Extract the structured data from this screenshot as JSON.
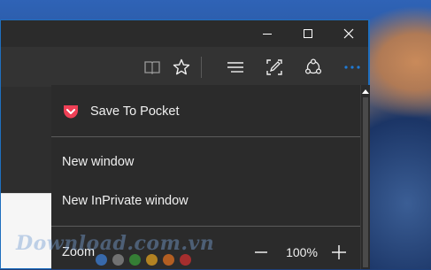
{
  "toolbar": {
    "reading_view_icon": "book-icon",
    "favorite_icon": "star-icon",
    "hub_icon": "hub-icon",
    "web_note_icon": "web-note-icon",
    "share_icon": "share-icon",
    "more_icon": "more-icon"
  },
  "menu": {
    "items": [
      {
        "label": "Save To Pocket",
        "icon": "pocket-icon"
      },
      {
        "label": "New window"
      },
      {
        "label": "New InPrivate window"
      }
    ],
    "zoom": {
      "label": "Zoom",
      "value": "100%"
    }
  },
  "watermark": {
    "text": "Download.com.vn",
    "dot_colors": [
      "#3d7fd6",
      "#8a8a8a",
      "#3a9b3a",
      "#e0a020",
      "#e07020",
      "#d03030"
    ]
  },
  "colors": {
    "accent": "#1f7bd6",
    "pocket": "#ef4056",
    "menu_bg": "#2b2b2b",
    "titlebar_bg": "#2b2b2b"
  }
}
